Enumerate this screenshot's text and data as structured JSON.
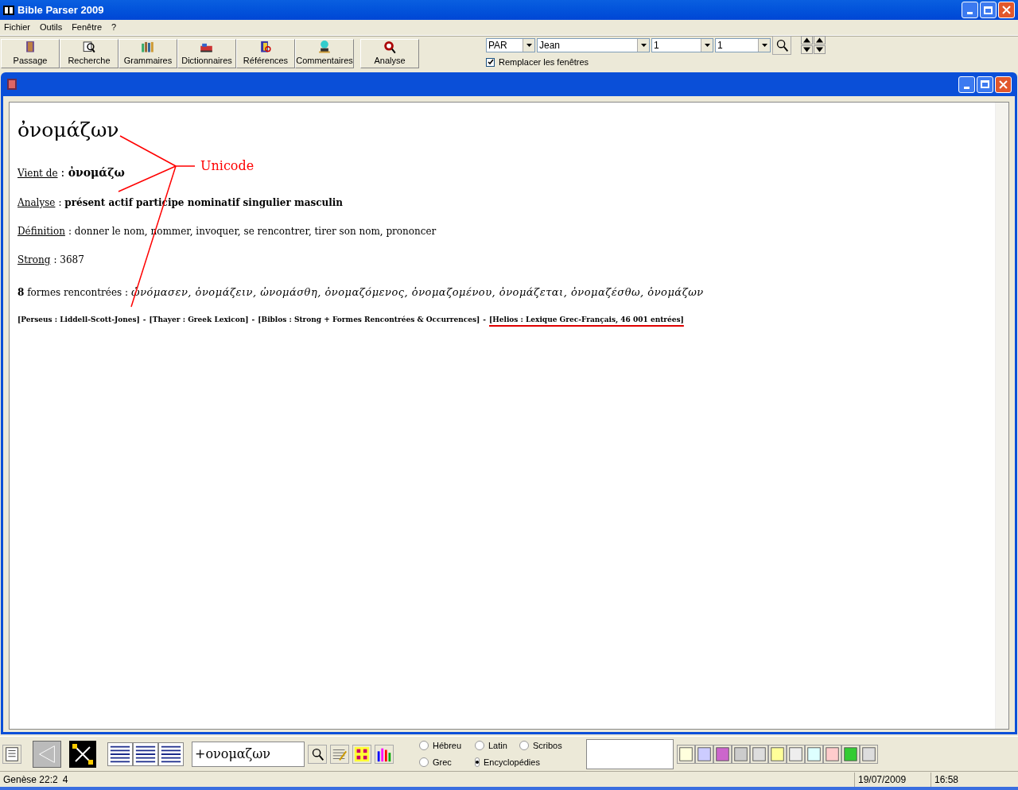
{
  "window": {
    "title": "Bible Parser 2009"
  },
  "menu": [
    {
      "label": "Fichier"
    },
    {
      "label": "Outils"
    },
    {
      "label": "Fenêtre"
    },
    {
      "label": "?"
    }
  ],
  "toolbar": [
    {
      "label": "Passage"
    },
    {
      "label": "Recherche"
    },
    {
      "label": "Grammaires"
    },
    {
      "label": "Dictionnaires"
    },
    {
      "label": "Références"
    },
    {
      "label": "Commentaires"
    },
    {
      "label": "Analyse"
    }
  ],
  "navigation": {
    "book_code": "PAR",
    "book": "Jean",
    "chapter": "1",
    "verse": "1",
    "replace_windows": {
      "label": "Remplacer les fenêtres",
      "checked": true
    }
  },
  "document": {
    "headword": "ὀνομάζων",
    "annotation": "Unicode",
    "fields": [
      {
        "label": "Vient de",
        "value": ": **ὀνομάζω**"
      },
      {
        "label": "Analyse",
        "value": ": **présent actif participe nominatif singulier masculin**"
      },
      {
        "label": "Définition",
        "value": ": donner le nom, nommer, invoquer, se rencontrer, tirer son nom, prononcer"
      },
      {
        "label": "Strong",
        "value": ": 3687"
      }
    ],
    "forms": {
      "label": "**8** formes rencontrées :",
      "items": "ὠνόμασεν, ὀνομάζειν, ὠνομάσθη, ὀνομαζόμενος, ὀνομαζομένου, ὀνομάζεται, ὀνομαζέσθω, ὀνομάζων"
    },
    "references": [
      {
        "kind": "source",
        "text": "[Perseus : Liddell-Scott-Jones]",
        "highlighted": false
      },
      {
        "kind": "separator",
        "text": "-"
      },
      {
        "kind": "source",
        "text": "[Thayer : Greek Lexicon]",
        "highlighted": false
      },
      {
        "kind": "separator",
        "text": "-"
      },
      {
        "kind": "source",
        "text": "[Biblos : Strong + Formes Rencontrées & Occurrences]",
        "highlighted": false
      },
      {
        "kind": "separator",
        "text": "-"
      },
      {
        "kind": "source",
        "text": "[Helios : Lexique Grec-Français, 46 001 entrées]",
        "highlighted": true
      }
    ]
  },
  "bottom_bar": {
    "search": {
      "value": "+ονομαζων"
    },
    "languages": [
      {
        "label": "Hébreu",
        "selected": false
      },
      {
        "label": "Latin",
        "selected": false
      },
      {
        "label": "Scribos",
        "selected": false
      },
      {
        "label": "Grec",
        "selected": false
      },
      {
        "label": "Encyclopédies",
        "selected": true
      }
    ]
  },
  "status_bar": {
    "reference": "Genèse 22:2",
    "count": "4",
    "date": "19/07/2009",
    "time": "16:58"
  }
}
